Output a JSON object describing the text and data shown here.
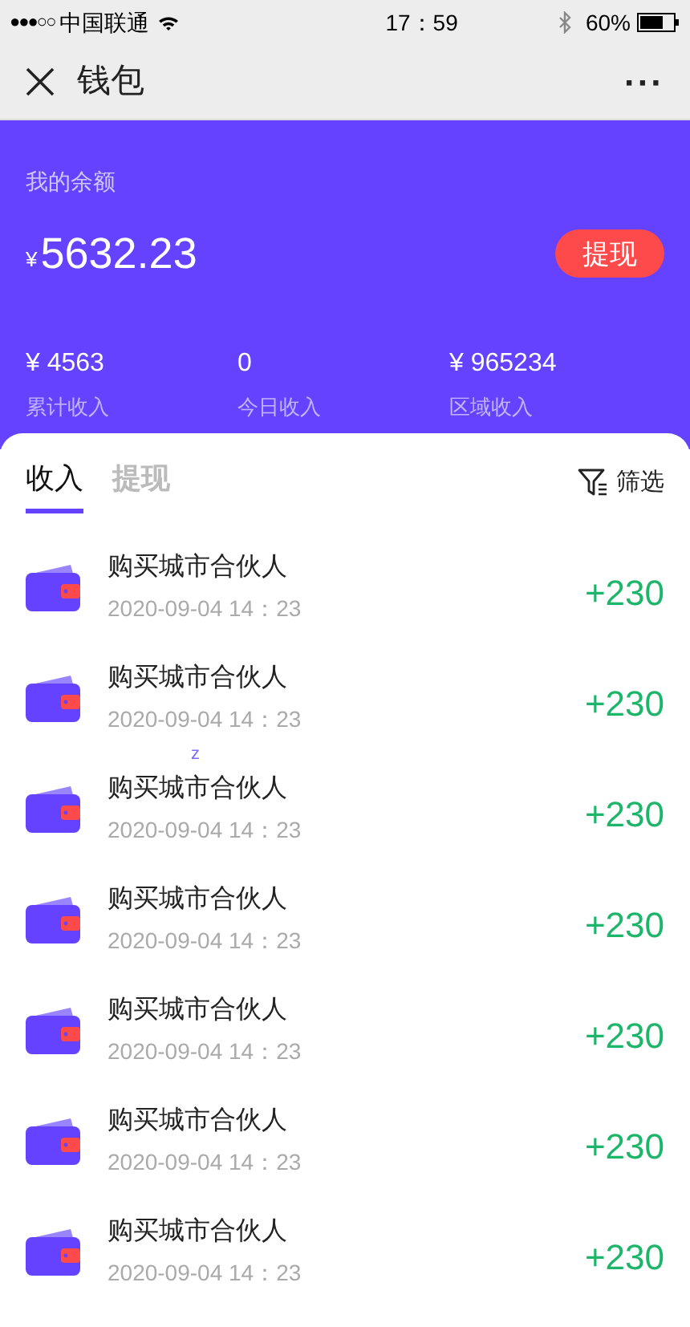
{
  "status_bar": {
    "signal": "●●●○○",
    "carrier": "中国联通",
    "time": "17：59",
    "battery": "60%"
  },
  "nav": {
    "title": "钱包",
    "more": "···"
  },
  "balance": {
    "label": "我的余额",
    "currency": "¥",
    "amount": "5632.23",
    "withdraw": "提现"
  },
  "stats": [
    {
      "value": "¥ 4563",
      "label": "累计收入"
    },
    {
      "value": "0",
      "label": "今日收入"
    },
    {
      "value": "¥ 965234",
      "label": "区域收入"
    }
  ],
  "tabs": [
    {
      "label": "收入",
      "selected": true
    },
    {
      "label": "提现",
      "selected": false
    }
  ],
  "filter": "筛选",
  "records": [
    {
      "title": "购买城市合伙人",
      "time": "2020-09-04 14：23",
      "amount": "+230"
    },
    {
      "title": "购买城市合伙人",
      "time": "2020-09-04 14：23",
      "amount": "+230"
    },
    {
      "title": "购买城市合伙人",
      "time": "2020-09-04 14：23",
      "amount": "+230",
      "mark": "z"
    },
    {
      "title": "购买城市合伙人",
      "time": "2020-09-04 14：23",
      "amount": "+230"
    },
    {
      "title": "购买城市合伙人",
      "time": "2020-09-04 14：23",
      "amount": "+230"
    },
    {
      "title": "购买城市合伙人",
      "time": "2020-09-04 14：23",
      "amount": "+230"
    },
    {
      "title": "购买城市合伙人",
      "time": "2020-09-04 14：23",
      "amount": "+230"
    }
  ]
}
